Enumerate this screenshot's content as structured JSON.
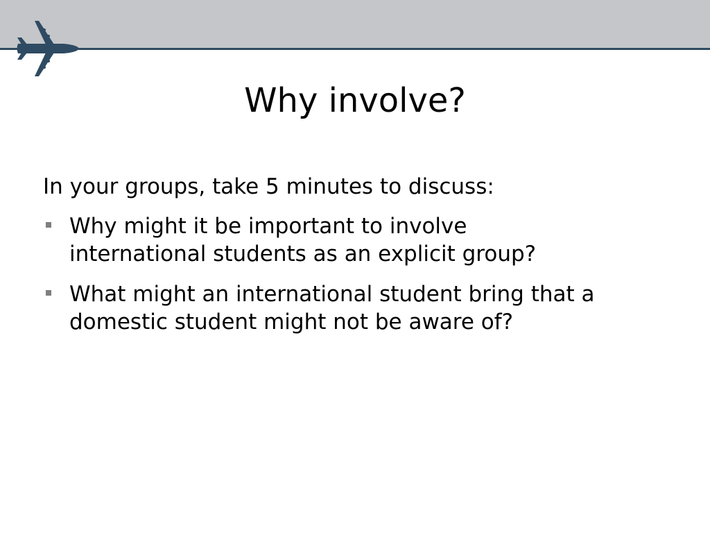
{
  "slide": {
    "title": "Why involve?",
    "intro": "In your groups, take 5 minutes to discuss:",
    "bullets": [
      {
        "lines": [
          "Why might it be important to involve",
          "international students as an explicit group?"
        ]
      },
      {
        "lines": [
          "What might an international student bring that a",
          "domestic student might not be aware of?"
        ]
      }
    ]
  },
  "theme": {
    "band_color": "#c4c6c9",
    "rule_color": "#2f4b63",
    "plane_color": "#2f4b63",
    "bullet_color": "#7f7f7f"
  },
  "icons": {
    "logo": "airplane-icon",
    "bullet": "square-bullet-icon"
  }
}
